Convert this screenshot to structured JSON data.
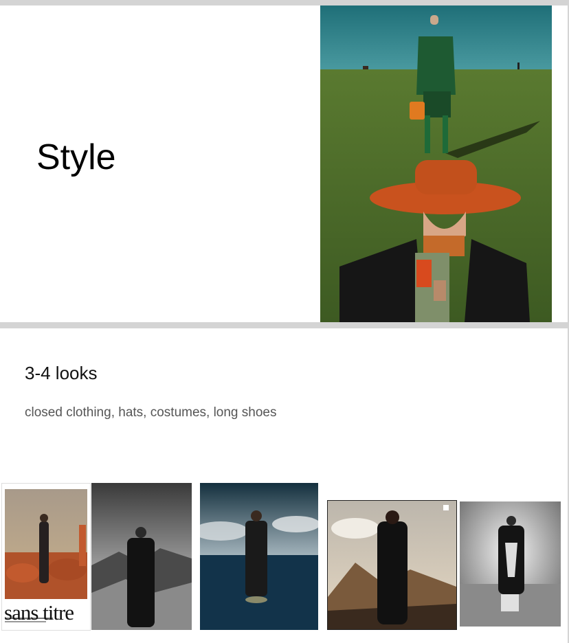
{
  "slide1": {
    "title": "Style"
  },
  "slide2": {
    "heading": "3-4 looks",
    "description": "closed clothing, hats, costumes, long shoes"
  },
  "thumbnails": {
    "magazine_title": "sans titre"
  },
  "colors": {
    "background": "#d4d4d4",
    "slide": "#ffffff",
    "sky": "#2f7e82",
    "grass": "#4a6b2a",
    "hat": "#c9521e",
    "suit_green": "#1e5a32"
  }
}
